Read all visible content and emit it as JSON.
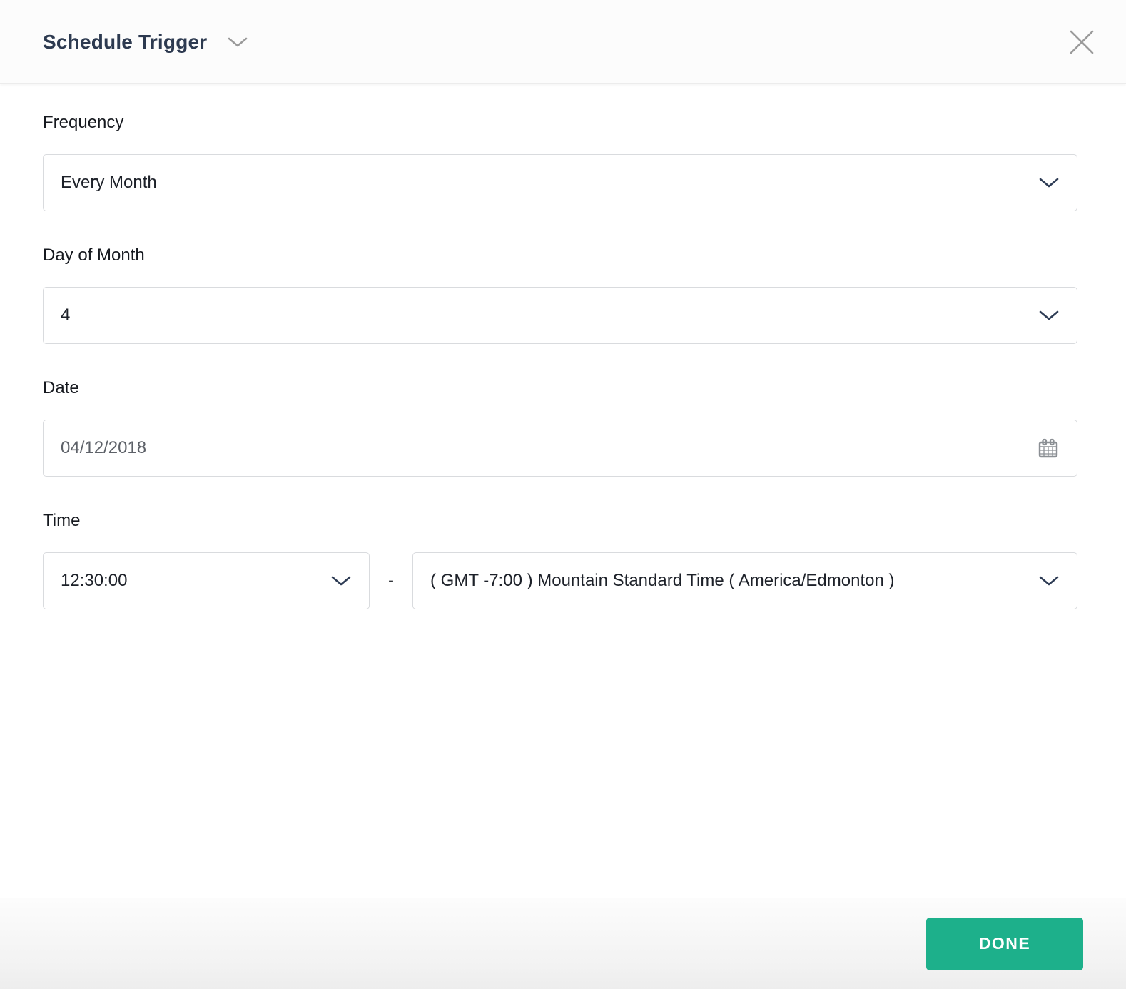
{
  "header": {
    "title": "Schedule Trigger"
  },
  "form": {
    "frequency": {
      "label": "Frequency",
      "value": "Every Month"
    },
    "day_of_month": {
      "label": "Day of Month",
      "value": "4"
    },
    "date": {
      "label": "Date",
      "value": "04/12/2018"
    },
    "time": {
      "label": "Time",
      "value": "12:30:00",
      "separator": "-",
      "timezone_value": "( GMT -7:00 ) Mountain Standard Time ( America/Edmonton )"
    }
  },
  "footer": {
    "done_label": "DONE"
  },
  "icons": {
    "title_chevron": "chevron-down",
    "close": "close-x",
    "select_chevron": "chevron-down",
    "calendar": "calendar"
  },
  "colors": {
    "accent": "#1db08b",
    "title_text": "#2d3a50",
    "field_border": "#d9dbde",
    "muted_text": "#5d6168",
    "icon_gray": "#9b9b9b"
  }
}
